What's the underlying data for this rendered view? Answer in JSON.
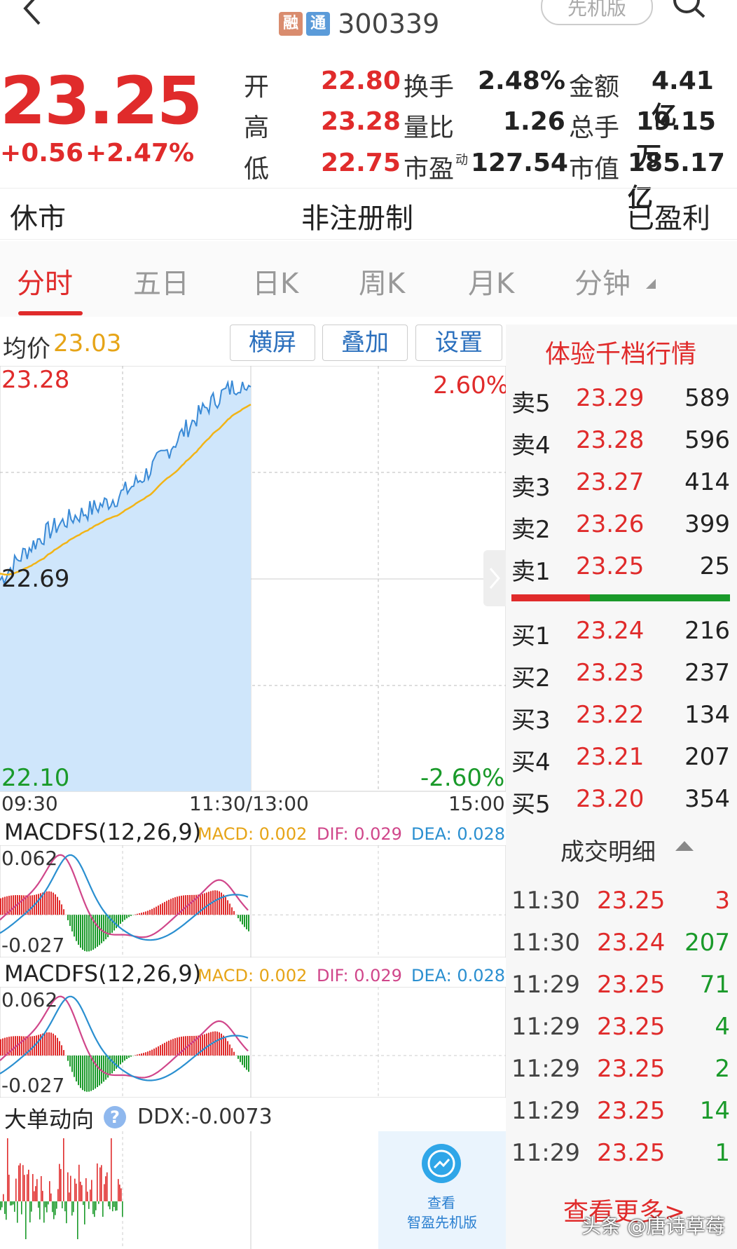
{
  "header": {
    "back_icon": "chevron-left-icon",
    "tag_rong": "融",
    "tag_tong": "通",
    "code": "300339",
    "badge": "先机版",
    "search_icon": "search-icon"
  },
  "quote": {
    "price": "23.25",
    "change": "+0.56",
    "change_pct": "+2.47%",
    "open_label": "开",
    "open": "22.80",
    "high_label": "高",
    "high": "23.28",
    "low_label": "低",
    "low": "22.75",
    "turnover_label": "换手",
    "turnover": "2.48%",
    "vol_ratio_label": "量比",
    "vol_ratio": "1.26",
    "pe_label": "市盈",
    "pe_sup": "动",
    "pe": "127.54",
    "amount_label": "金额",
    "amount": "4.41亿",
    "total_hands_label": "总手",
    "total_hands": "19.15万",
    "mktcap_label": "市值",
    "mktcap": "185.17亿"
  },
  "status": {
    "market": "休市",
    "reg": "非注册制",
    "profit": "已盈利"
  },
  "tabs": [
    "分时",
    "五日",
    "日K",
    "周K",
    "月K",
    "分钟"
  ],
  "chart_header": {
    "avg_label": "均价",
    "avg_value": "23.03",
    "btn_landscape": "横屏",
    "btn_overlay": "叠加",
    "btn_settings": "设置"
  },
  "intraday": {
    "y_top": "23.28",
    "y_mid": "22.69",
    "y_bottom": "22.10",
    "pct_top": "2.60%",
    "pct_bottom": "-2.60%",
    "t_start": "09:30",
    "t_mid": "11:30/13:00",
    "t_end": "15:00"
  },
  "macd1": {
    "title": "MACDFS(12,26,9)",
    "macd": "MACD: 0.002",
    "dif": "DIF: 0.029",
    "dea": "DEA: 0.028",
    "y_top": "0.062",
    "y_bottom": "-0.027"
  },
  "macd2": {
    "title": "MACDFS(12,26,9)",
    "macd": "MACD: 0.002",
    "dif": "DIF: 0.029",
    "dea": "DEA: 0.028",
    "y_top": "0.062",
    "y_bottom": "-0.027"
  },
  "ddx": {
    "title": "大单动向",
    "help_icon": "question-icon",
    "value": "DDX:-0.0073",
    "promo_line1": "查看",
    "promo_line2": "智盈先机版"
  },
  "orderbook": {
    "title": "体验千档行情",
    "asks": [
      {
        "label": "卖5",
        "price": "23.29",
        "vol": "589"
      },
      {
        "label": "卖4",
        "price": "23.28",
        "vol": "596"
      },
      {
        "label": "卖3",
        "price": "23.27",
        "vol": "414"
      },
      {
        "label": "卖2",
        "price": "23.26",
        "vol": "399"
      },
      {
        "label": "卖1",
        "price": "23.25",
        "vol": "25"
      }
    ],
    "bids": [
      {
        "label": "买1",
        "price": "23.24",
        "vol": "216"
      },
      {
        "label": "买2",
        "price": "23.23",
        "vol": "237"
      },
      {
        "label": "买3",
        "price": "23.22",
        "vol": "134"
      },
      {
        "label": "买4",
        "price": "23.21",
        "vol": "207"
      },
      {
        "label": "买5",
        "price": "23.20",
        "vol": "354"
      }
    ]
  },
  "trades": {
    "title": "成交明细",
    "rows": [
      {
        "time": "11:30",
        "price": "23.25",
        "vol": "3",
        "dir": "up"
      },
      {
        "time": "11:30",
        "price": "23.24",
        "vol": "207",
        "dir": "down"
      },
      {
        "time": "11:29",
        "price": "23.25",
        "vol": "71",
        "dir": "down"
      },
      {
        "time": "11:29",
        "price": "23.25",
        "vol": "4",
        "dir": "down"
      },
      {
        "time": "11:29",
        "price": "23.25",
        "vol": "2",
        "dir": "down"
      },
      {
        "time": "11:29",
        "price": "23.25",
        "vol": "14",
        "dir": "down"
      },
      {
        "time": "11:29",
        "price": "23.25",
        "vol": "1",
        "dir": "down"
      }
    ],
    "more": "查看更多>",
    "watermark": "头条 @唐诗草莓"
  },
  "colors": {
    "up": "#e02b2b",
    "down": "#1a9a2a",
    "price_line": "#3a8ad6",
    "avg_line": "#f2b416"
  }
}
